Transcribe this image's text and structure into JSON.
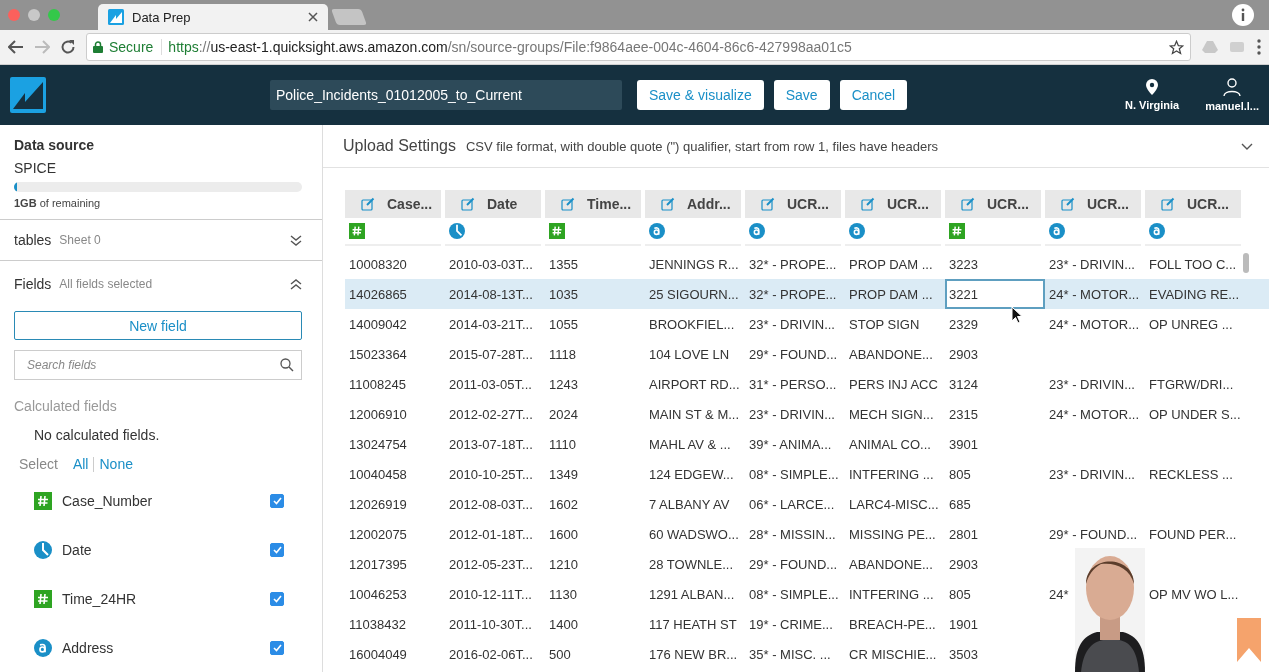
{
  "browser": {
    "tab_title": "Data Prep",
    "security_label": "Secure",
    "url_scheme": "https",
    "url_separator": "://",
    "url_host": "us-east-1.quicksight.aws.amazon.com",
    "url_path": "/sn/source-groups/File:f9864aee-004c-4604-86c6-427998aa01c5"
  },
  "header": {
    "dataset_name": "Police_Incidents_01012005_to_Current",
    "buttons": [
      "Save & visualize",
      "Save",
      "Cancel"
    ],
    "region": "N. Virginia",
    "user": "manuel.l..."
  },
  "sidebar": {
    "data_source": {
      "title": "Data source",
      "engine": "SPICE",
      "level": 0.01,
      "capacity": "**1GB** of remaining"
    },
    "sections": [
      {
        "title": "tables",
        "subtitle": "Sheet 0",
        "expanded": false
      },
      {
        "title": "Fields",
        "subtitle": "All fields selected",
        "expanded": true
      }
    ],
    "new_field_button": "New field",
    "search": {
      "placeholder": "Search fields"
    },
    "calculated_title": "Calculated fields",
    "calculated_empty": "No calculated fields.",
    "select_label": "Select",
    "select_all": "All",
    "select_none": "None",
    "fields": [
      {
        "name": "Case_Number",
        "kind": "number",
        "checked": true
      },
      {
        "name": "Date",
        "kind": "date",
        "checked": true
      },
      {
        "name": "Time_24HR",
        "kind": "number",
        "checked": true
      },
      {
        "name": "Address",
        "kind": "string",
        "checked": true
      }
    ]
  },
  "upload_settings": {
    "title": "Upload Settings",
    "description": "CSV file format, with double quote (\") qualifier, start from row 1, files have headers",
    "expanded": false
  },
  "table": {
    "columns": [
      {
        "label": "Case...",
        "kind": "number"
      },
      {
        "label": "Date",
        "kind": "date"
      },
      {
        "label": "Time...",
        "kind": "number"
      },
      {
        "label": "Addr...",
        "kind": "string"
      },
      {
        "label": "UCR...",
        "kind": "string"
      },
      {
        "label": "UCR...",
        "kind": "string"
      },
      {
        "label": "UCR...",
        "kind": "number"
      },
      {
        "label": "UCR...",
        "kind": "string"
      },
      {
        "label": "UCR...",
        "kind": "string"
      }
    ],
    "rows": [
      {
        "selected": false,
        "cells": [
          "10008320",
          "2010-03-03T...",
          "1355",
          "JENNINGS R...",
          "32* - PROPE...",
          "PROP DAM ...",
          "3223",
          "23* - DRIVIN...",
          "FOLL TOO C..."
        ]
      },
      {
        "selected": true,
        "cells": [
          "14026865",
          "2014-08-13T...",
          "1035",
          "25 SIGOURN...",
          "32* - PROPE...",
          "PROP DAM ...",
          {
            "text": "3221",
            "focused": true
          },
          "24* - MOTOR...",
          "EVADING RE..."
        ]
      },
      {
        "selected": false,
        "cells": [
          "14009042",
          "2014-03-21T...",
          "1055",
          "BROOKFIEL...",
          "23* - DRIVIN...",
          "STOP SIGN",
          "2329",
          "24* - MOTOR...",
          "OP UNREG ..."
        ]
      },
      {
        "selected": false,
        "cells": [
          "15023364",
          "2015-07-28T...",
          "1118",
          "104 LOVE LN",
          "29* - FOUND...",
          "ABANDONE...",
          "2903",
          null,
          null
        ]
      },
      {
        "selected": false,
        "cells": [
          "11008245",
          "2011-03-05T...",
          "1243",
          "AIRPORT RD...",
          "31* - PERSO...",
          "PERS INJ ACC",
          "3124",
          "23* - DRIVIN...",
          "FTGRW/DRI..."
        ]
      },
      {
        "selected": false,
        "cells": [
          "12006910",
          "2012-02-27T...",
          "2024",
          "MAIN ST & M...",
          "23* - DRIVIN...",
          "MECH SIGN...",
          "2315",
          "24* - MOTOR...",
          "OP UNDER S..."
        ]
      },
      {
        "selected": false,
        "cells": [
          "13024754",
          "2013-07-18T...",
          "1110",
          "MAHL AV & ...",
          "39* - ANIMA...",
          "ANIMAL CO...",
          "3901",
          null,
          null
        ]
      },
      {
        "selected": false,
        "cells": [
          "10040458",
          "2010-10-25T...",
          "1349",
          "124 EDGEW...",
          "08* - SIMPLE...",
          "INTFERING ...",
          "805",
          "23* - DRIVIN...",
          "RECKLESS ..."
        ]
      },
      {
        "selected": false,
        "cells": [
          "12026919",
          "2012-08-03T...",
          "1602",
          "7 ALBANY AV",
          "06* - LARCE...",
          "LARC4-MISC...",
          "685",
          null,
          null
        ]
      },
      {
        "selected": false,
        "cells": [
          "12002075",
          "2012-01-18T...",
          "1600",
          "60 WADSWO...",
          "28* - MISSIN...",
          "MISSING PE...",
          "2801",
          "29* - FOUND...",
          "FOUND PER..."
        ]
      },
      {
        "selected": false,
        "cells": [
          "12017395",
          "2012-05-23T...",
          "1210",
          "28 TOWNLE...",
          "29* - FOUND...",
          "ABANDONE...",
          "2903",
          null,
          null
        ]
      },
      {
        "selected": false,
        "cells": [
          "10046253",
          "2010-12-11T...",
          "1130",
          "1291 ALBAN...",
          "08* - SIMPLE...",
          "INTFERING ...",
          "805",
          "24*",
          "OP MV WO L..."
        ]
      },
      {
        "selected": false,
        "cells": [
          "11038432",
          "2011-10-30T...",
          "1400",
          "117 HEATH ST",
          "19* - CRIME...",
          "BREACH-PE...",
          "1901",
          null,
          null
        ]
      },
      {
        "selected": false,
        "cells": [
          "16004049",
          "2016-02-06T...",
          "500",
          "176 NEW BR...",
          "35* - MISC. ...",
          "CR MISCHIE...",
          "3503",
          null,
          null
        ]
      }
    ]
  }
}
